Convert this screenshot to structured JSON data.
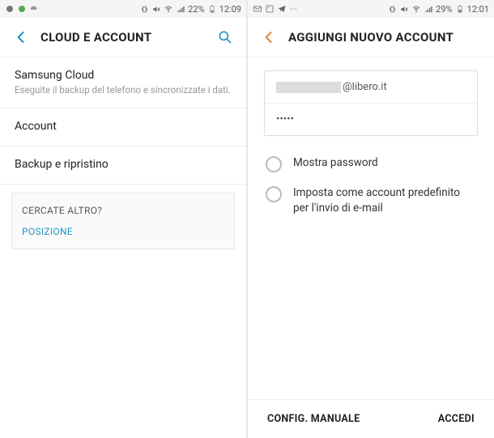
{
  "left": {
    "status": {
      "battery": "22%",
      "time": "12:09"
    },
    "header": {
      "title": "CLOUD E ACCOUNT"
    },
    "items": [
      {
        "title": "Samsung Cloud",
        "sub": "Eseguite il backup del telefono e sincronizzate i dati."
      },
      {
        "title": "Account",
        "sub": ""
      },
      {
        "title": "Backup e ripristino",
        "sub": ""
      }
    ],
    "section": {
      "title": "CERCATE ALTRO?",
      "link": "POSIZIONE"
    }
  },
  "right": {
    "status": {
      "battery": "29%",
      "time": "12:01"
    },
    "header": {
      "title": "AGGIUNGI NUOVO ACCOUNT"
    },
    "form": {
      "email_domain": "@libero.it",
      "password": "•••••",
      "show_password": "Mostra password",
      "default_account": "Imposta come account predefinito per l'invio di e-mail"
    },
    "footer": {
      "manual": "CONFIG. MANUALE",
      "signin": "ACCEDI"
    }
  }
}
